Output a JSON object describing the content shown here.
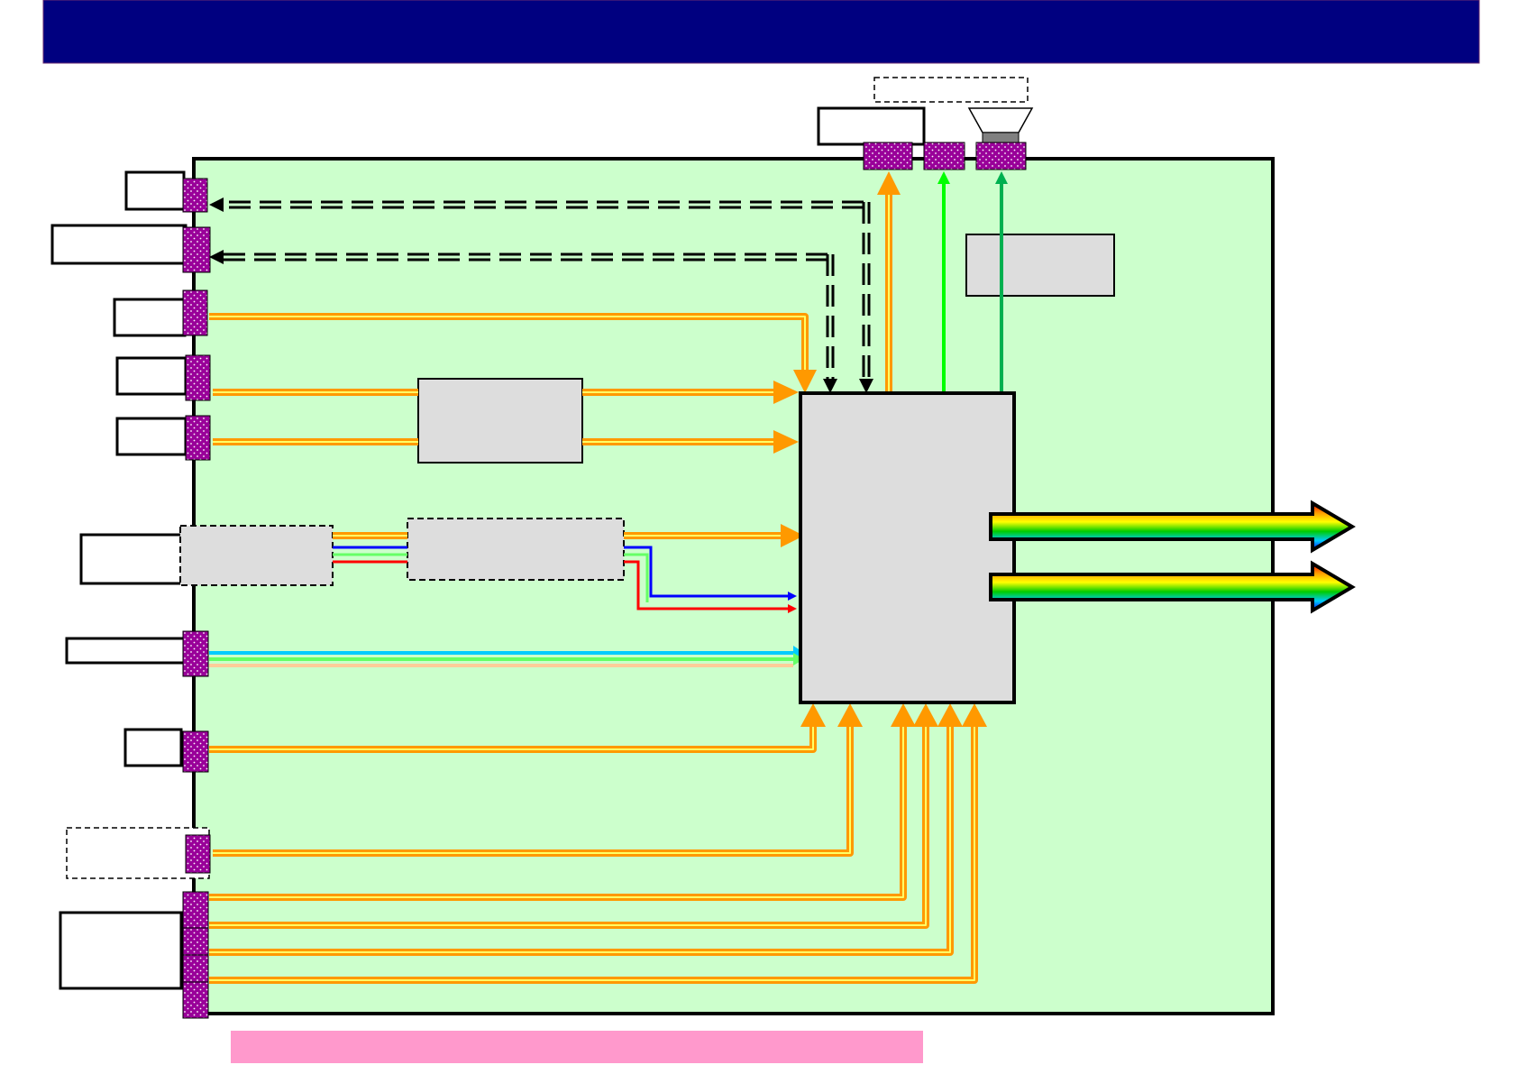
{
  "header": {
    "title": ""
  },
  "colors": {
    "header_bar": "#000080",
    "board": "#ccffcc",
    "connector": "#990099",
    "block": "#dddddd",
    "bus": "#ff9900",
    "green_line": "#00ff00",
    "dark_green_line": "#00b050",
    "blue_line": "#0000ff",
    "red_line": "#ff0000",
    "cyan_line": "#00ccff",
    "footer_note_bar": "#ff99cc"
  },
  "left_connectors": [
    {
      "label": ""
    },
    {
      "label": ""
    },
    {
      "label": ""
    },
    {
      "label": ""
    },
    {
      "label": ""
    },
    {
      "label": ""
    },
    {
      "label": ""
    },
    {
      "label": ""
    },
    {
      "label": ""
    },
    {
      "label": ""
    }
  ],
  "top_connectors": [
    {
      "label": ""
    },
    {
      "label": ""
    },
    {
      "label": ""
    }
  ],
  "blocks": {
    "main_processor": "",
    "upper_converter": "",
    "right_block": "",
    "dashed_block_left": "",
    "dashed_block_mid": ""
  },
  "outputs": [
    {
      "label": ""
    },
    {
      "label": ""
    }
  ],
  "speaker": {
    "icon": "speaker-icon"
  },
  "footer_note": {
    "text": ""
  }
}
